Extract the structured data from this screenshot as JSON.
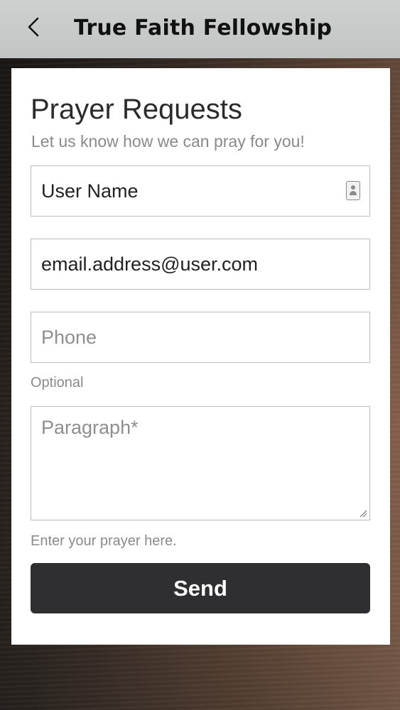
{
  "header": {
    "title": "True Faith Fellowship",
    "back_icon": "chevron-left-icon"
  },
  "form": {
    "title": "Prayer Requests",
    "subtitle": "Let us know how we can pray for you!",
    "name_value": "User Name",
    "name_icon": "contact-card-icon",
    "email_value": "email.address@user.com",
    "phone_placeholder": "Phone",
    "phone_hint": "Optional",
    "paragraph_placeholder": "Paragraph*",
    "paragraph_hint": "Enter your prayer here.",
    "send_label": "Send"
  },
  "colors": {
    "header_bg": "#c8c9c9",
    "button_bg": "#2f2e30",
    "card_bg": "#ffffff"
  }
}
